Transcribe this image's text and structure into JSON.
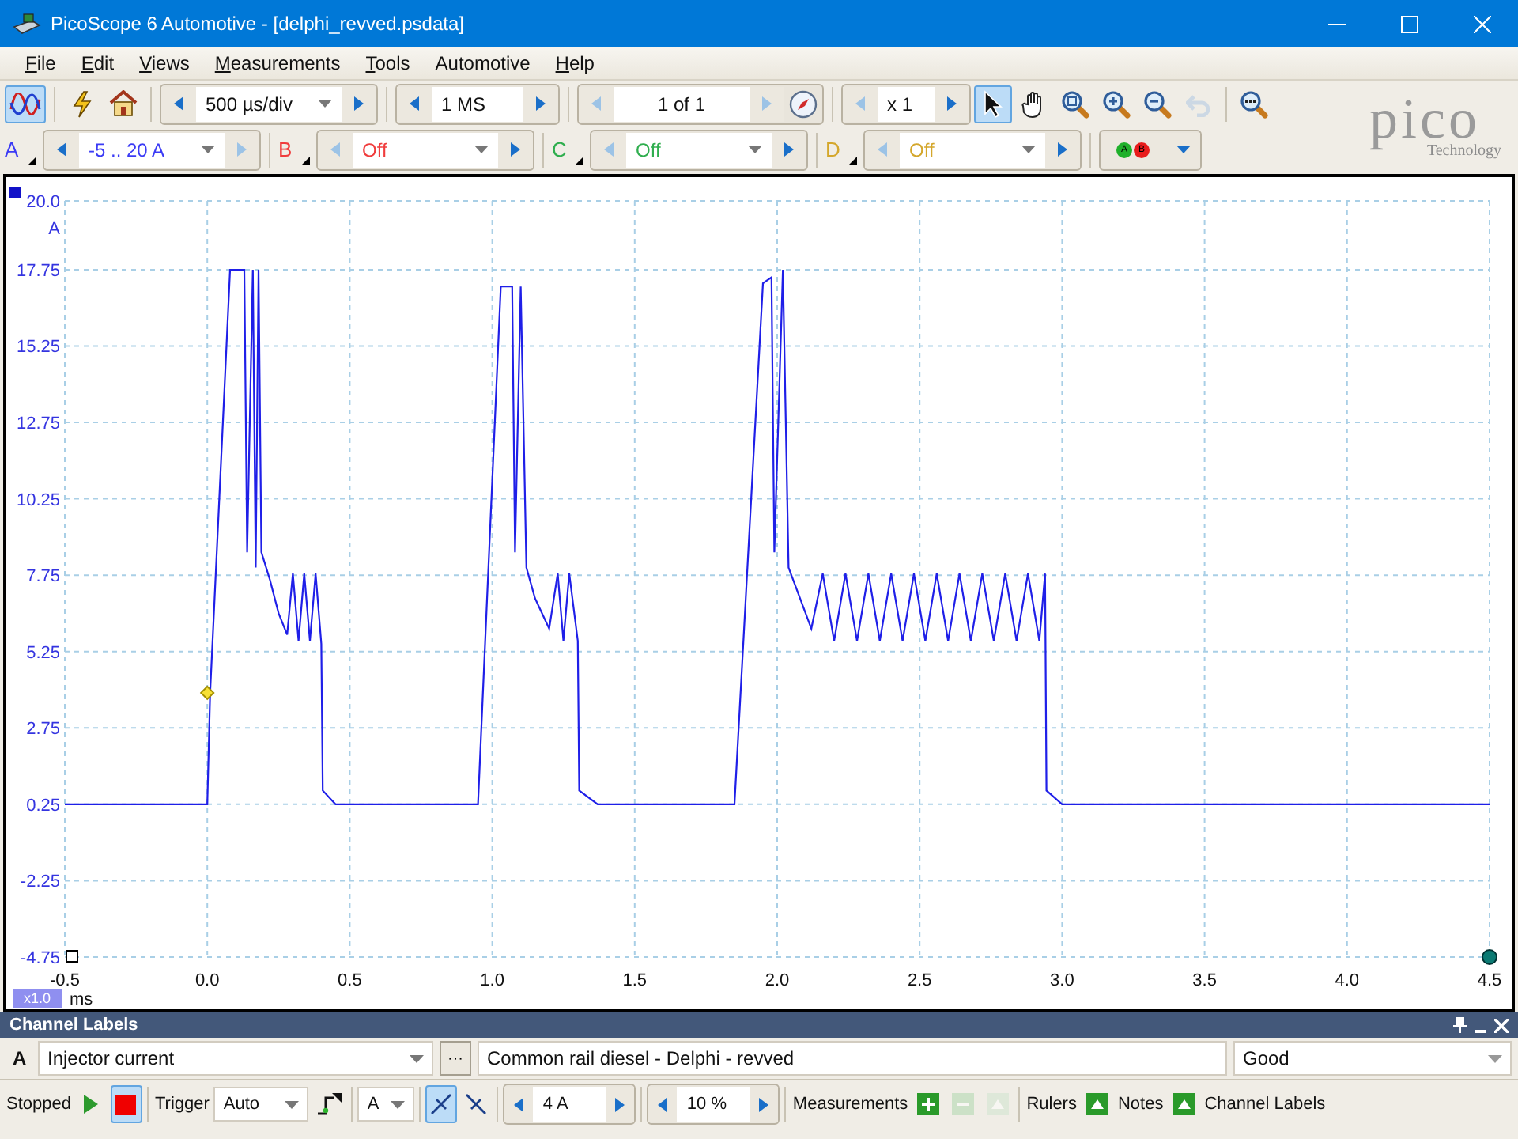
{
  "window": {
    "title": "PicoScope 6 Automotive - [delphi_revved.psdata]"
  },
  "menu": [
    {
      "label": "File",
      "mnemonic": true
    },
    {
      "label": "Edit",
      "mnemonic": true
    },
    {
      "label": "Views",
      "mnemonic": true
    },
    {
      "label": "Measurements",
      "mnemonic": true
    },
    {
      "label": "Tools",
      "mnemonic": true
    },
    {
      "label": "Automotive",
      "mnemonic": false
    },
    {
      "label": "Help",
      "mnemonic": true
    }
  ],
  "toolbar": {
    "scope_mode_selected": true,
    "timebase": {
      "value": "500 µs/div",
      "dropdown": true,
      "prev_disabled": false,
      "next_disabled": false
    },
    "samples": {
      "value": "1 MS",
      "dropdown": false,
      "prev_disabled": false,
      "next_disabled": false
    },
    "buffer": {
      "value": "1 of 1",
      "dropdown": false,
      "prev_disabled": true,
      "next_disabled": true
    },
    "zoom": {
      "value": "x 1",
      "dropdown": false,
      "prev_disabled": true,
      "next_disabled": false
    },
    "tools": [
      {
        "kind": "pointer",
        "selected": true,
        "disabled": false
      },
      {
        "kind": "hand",
        "selected": false,
        "disabled": false
      },
      {
        "kind": "zoom-area",
        "selected": false,
        "disabled": false
      },
      {
        "kind": "zoom-in",
        "selected": false,
        "disabled": false
      },
      {
        "kind": "zoom-out",
        "selected": false,
        "disabled": false
      },
      {
        "kind": "undo",
        "selected": false,
        "disabled": true
      },
      {
        "kind": "zoom-full",
        "selected": false,
        "disabled": false
      }
    ]
  },
  "logo": {
    "name": "pico",
    "tagline": "Technology"
  },
  "channels": [
    {
      "letter": "A",
      "range": "-5 .. 20 A",
      "color": "#3b3bf5",
      "prev_disabled": false,
      "next_disabled": true
    },
    {
      "letter": "B",
      "range": "Off",
      "color": "#f03c3c",
      "prev_disabled": true,
      "next_disabled": false
    },
    {
      "letter": "C",
      "range": "Off",
      "color": "#2fae4e",
      "prev_disabled": true,
      "next_disabled": false
    },
    {
      "letter": "D",
      "range": "Off",
      "color": "#d4a72c",
      "prev_disabled": true,
      "next_disabled": false
    }
  ],
  "ruler_buttons": [
    {
      "letter": "A",
      "color": "#1fb02a"
    },
    {
      "letter": "B",
      "color": "#e81c1c"
    }
  ],
  "plot": {
    "y_unit": "A",
    "x_unit": "ms",
    "zoom_badge": "x1.0",
    "chart_data": {
      "type": "line",
      "grid": true,
      "xlim": [
        -0.5,
        4.5
      ],
      "ylim": [
        -4.75,
        20.0
      ],
      "xticks": [
        {
          "value": -0.5,
          "label": "-0.5"
        },
        {
          "value": 0,
          "label": "0.0"
        },
        {
          "value": 0.5,
          "label": "0.5"
        },
        {
          "value": 1,
          "label": "1.0"
        },
        {
          "value": 1.5,
          "label": "1.5"
        },
        {
          "value": 2,
          "label": "2.0"
        },
        {
          "value": 2.5,
          "label": "2.5"
        },
        {
          "value": 3,
          "label": "3.0"
        },
        {
          "value": 3.5,
          "label": "3.5"
        },
        {
          "value": 4,
          "label": "4.0"
        },
        {
          "value": 4.5,
          "label": "4.5"
        }
      ],
      "yticks": [
        {
          "value": 20,
          "label": "20.0"
        },
        17.75,
        15.25,
        12.75,
        10.25,
        7.75,
        5.25,
        2.75,
        0.25,
        -2.25,
        -4.75
      ],
      "x": [
        -0.5,
        0.0,
        0.01,
        0.08,
        0.13,
        0.14,
        0.16,
        0.17,
        0.18,
        0.19,
        0.22,
        0.25,
        0.28,
        0.3,
        0.32,
        0.34,
        0.36,
        0.38,
        0.4,
        0.405,
        0.45,
        0.95,
        1.03,
        1.07,
        1.08,
        1.1,
        1.12,
        1.15,
        1.2,
        1.23,
        1.25,
        1.27,
        1.3,
        1.305,
        1.37,
        1.85,
        1.95,
        1.98,
        1.99,
        2.02,
        2.04,
        2.08,
        2.12,
        2.16,
        2.2,
        2.24,
        2.28,
        2.32,
        2.36,
        2.4,
        2.44,
        2.48,
        2.52,
        2.56,
        2.6,
        2.64,
        2.68,
        2.72,
        2.76,
        2.8,
        2.84,
        2.88,
        2.92,
        2.94,
        2.945,
        3.0,
        4.5
      ],
      "series": [
        {
          "color": "#1f1fe8",
          "values": [
            0.25,
            0.25,
            3.9,
            17.75,
            17.75,
            8.5,
            17.75,
            8.0,
            17.75,
            8.5,
            7.6,
            6.5,
            5.8,
            7.8,
            5.6,
            7.8,
            5.6,
            7.8,
            5.5,
            0.7,
            0.25,
            0.25,
            17.2,
            17.2,
            8.5,
            17.2,
            8.0,
            7.0,
            6.0,
            7.8,
            5.6,
            7.8,
            5.6,
            0.7,
            0.25,
            0.25,
            17.3,
            17.5,
            8.5,
            17.75,
            8.0,
            7.0,
            6.0,
            7.8,
            5.6,
            7.8,
            5.6,
            7.8,
            5.6,
            7.8,
            5.6,
            7.8,
            5.6,
            7.8,
            5.6,
            7.8,
            5.6,
            7.8,
            5.6,
            7.8,
            5.6,
            7.8,
            5.6,
            7.8,
            0.7,
            0.25,
            0.25
          ]
        }
      ]
    }
  },
  "channel_labels": {
    "title": "Channel Labels",
    "channel": "A",
    "label": "Injector current",
    "more": "···",
    "description": "Common rail diesel - Delphi - revved",
    "quality": "Good"
  },
  "status_bar": {
    "state": "Stopped",
    "running": false,
    "trigger_label": "Trigger",
    "trigger_mode": "Auto",
    "trigger_channel": "A",
    "edges": [
      {
        "kind": "rising",
        "selected": true
      },
      {
        "kind": "falling",
        "selected": false
      }
    ],
    "threshold": {
      "value": "4 A",
      "dropdown": false,
      "prev_disabled": false,
      "next_disabled": false
    },
    "pretrigger": {
      "value": "10 %",
      "dropdown": false,
      "prev_disabled": false,
      "next_disabled": false
    },
    "measurements_label": "Measurements",
    "rulers_label": "Rulers",
    "notes_label": "Notes",
    "channel_labels_label": "Channel Labels"
  }
}
